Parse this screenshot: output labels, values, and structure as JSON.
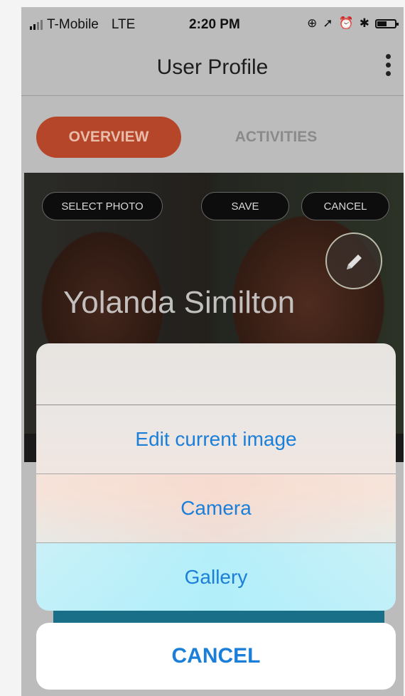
{
  "status_bar": {
    "carrier": "T-Mobile",
    "network": "LTE",
    "time": "2:20 PM"
  },
  "header": {
    "title": "User Profile"
  },
  "tabs": [
    {
      "label": "OVERVIEW",
      "selected": true
    },
    {
      "label": "ACTIVITIES",
      "selected": false
    }
  ],
  "photo_actions": {
    "select_photo": "SELECT PHOTO",
    "save": "SAVE",
    "cancel": "CANCEL"
  },
  "profile": {
    "name": "Yolanda Similton"
  },
  "action_sheet": {
    "options": [
      "Edit current image",
      "Camera",
      "Gallery"
    ],
    "cancel": "CANCEL"
  },
  "colors": {
    "accent": "#b5462a",
    "ios_blue": "#1b7fd9"
  }
}
